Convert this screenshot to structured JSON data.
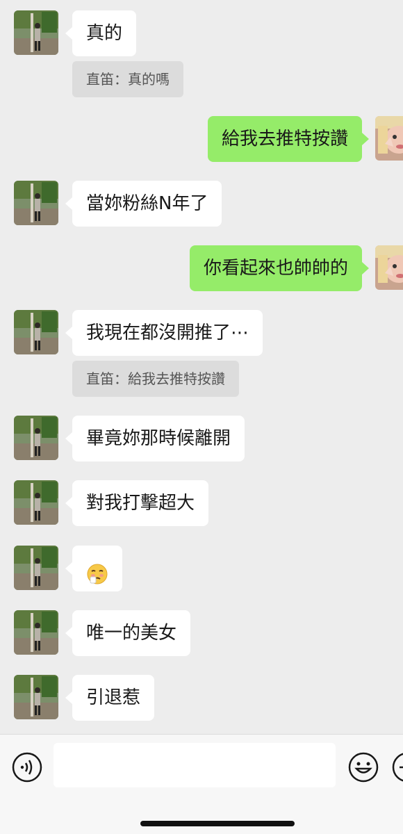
{
  "messages": [
    {
      "side": "in",
      "text": "真的"
    },
    {
      "type": "quote",
      "text": "直笛：真的嗎"
    },
    {
      "side": "out",
      "text": "給我去推特按讚"
    },
    {
      "side": "in",
      "text": "當妳粉絲N年了"
    },
    {
      "side": "out",
      "text": "你看起來也帥帥的"
    },
    {
      "side": "in",
      "text": "我現在都沒開推了⋯"
    },
    {
      "type": "quote",
      "text": "直笛：給我去推特按讚"
    },
    {
      "side": "in",
      "text": "畢竟妳那時候離開"
    },
    {
      "side": "in",
      "text": "對我打擊超大"
    },
    {
      "side": "in",
      "emoji": "tired-face-emoji"
    },
    {
      "side": "in",
      "text": "唯一的美女"
    },
    {
      "side": "in",
      "text": "引退惹"
    }
  ],
  "colors": {
    "background": "#ededed",
    "incoming_bubble": "#ffffff",
    "outgoing_bubble": "#95ec69",
    "quote_bg": "#dcdcdc"
  },
  "inputbar": {
    "left_icon": "voice-icon",
    "right_icon": "emoji-icon",
    "far_right_icon": "plus-icon"
  }
}
